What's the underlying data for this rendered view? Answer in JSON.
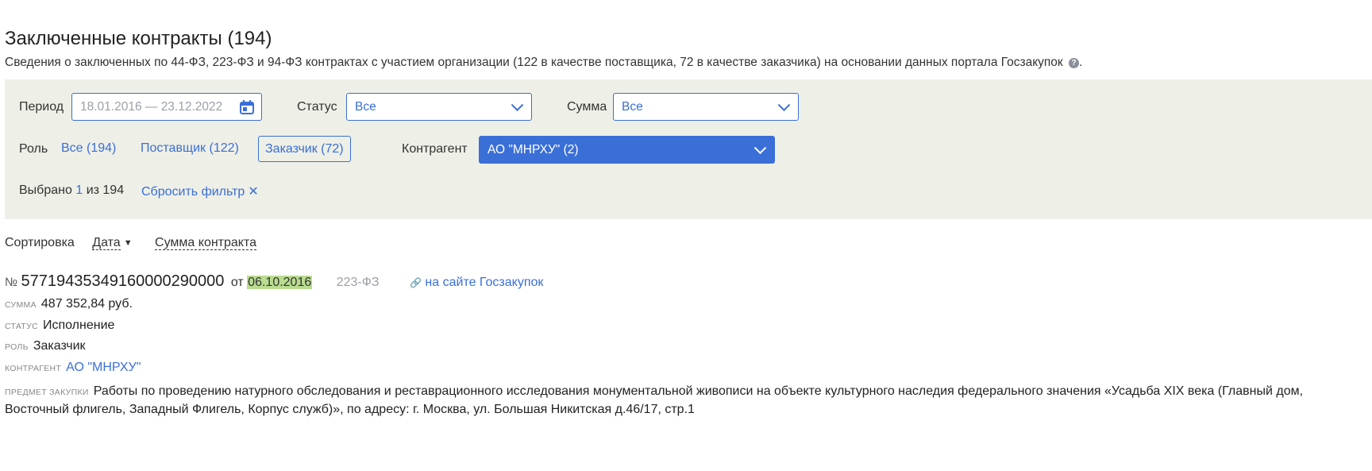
{
  "header": {
    "title": "Заключенные контракты (194)",
    "subtitle": "Сведения о заключенных по 44-ФЗ, 223-ФЗ и 94-ФЗ контрактах с участием организации (122 в качестве поставщика, 72 в качестве заказчика) на основании данных портала Госзакупок",
    "help_icon": "?",
    "subtitle_end": "."
  },
  "filters": {
    "period_label": "Период",
    "period_value": "18.01.2016 — 23.12.2022",
    "status_label": "Статус",
    "status_value": "Все",
    "sum_label": "Сумма",
    "sum_value": "Все",
    "role_label": "Роль",
    "role_all": "Все (194)",
    "role_supplier": "Поставщик (122)",
    "role_customer": "Заказчик (72)",
    "counterparty_label": "Контрагент",
    "counterparty_value": "АО \"МНРХУ\" (2)",
    "selected_prefix": "Выбрано",
    "selected_count": "1",
    "selected_suffix": "из 194",
    "reset_label": "Сбросить фильтр",
    "reset_icon": "✕"
  },
  "sort": {
    "label": "Сортировка",
    "date": "Дата",
    "date_arrow": "▼",
    "sum": "Сумма контракта"
  },
  "contract": {
    "no_sign": "№",
    "number": "57719435349160000290000",
    "from": "от",
    "date": "06.10.2016",
    "law": "223-ФЗ",
    "link_icon": "🔗",
    "external_link": "на сайте Госзакупок",
    "sum_label": "сумма",
    "sum_value": "487 352,84 руб.",
    "status_label": "статус",
    "status_value": "Исполнение",
    "role_label": "роль",
    "role_value": "Заказчик",
    "counterparty_label": "контрагент",
    "counterparty_value": "АО \"МНРХУ\"",
    "subject_label": "предмет закупки",
    "subject_value": "Работы по проведению натурного обследования и реставрационного исследования монументальной живописи на объекте культурного наследия федерального значения «Усадьба XIX века (Главный дом, Восточный флигель, Западный Флигель, Корпус служб)», по адресу: г. Москва, ул. Большая Никитская д.46/17, стр.1"
  },
  "colors": {
    "accent": "#3a6fd8",
    "filter_bg": "#eeefe6",
    "date_highlight": "#b9dc8f"
  }
}
